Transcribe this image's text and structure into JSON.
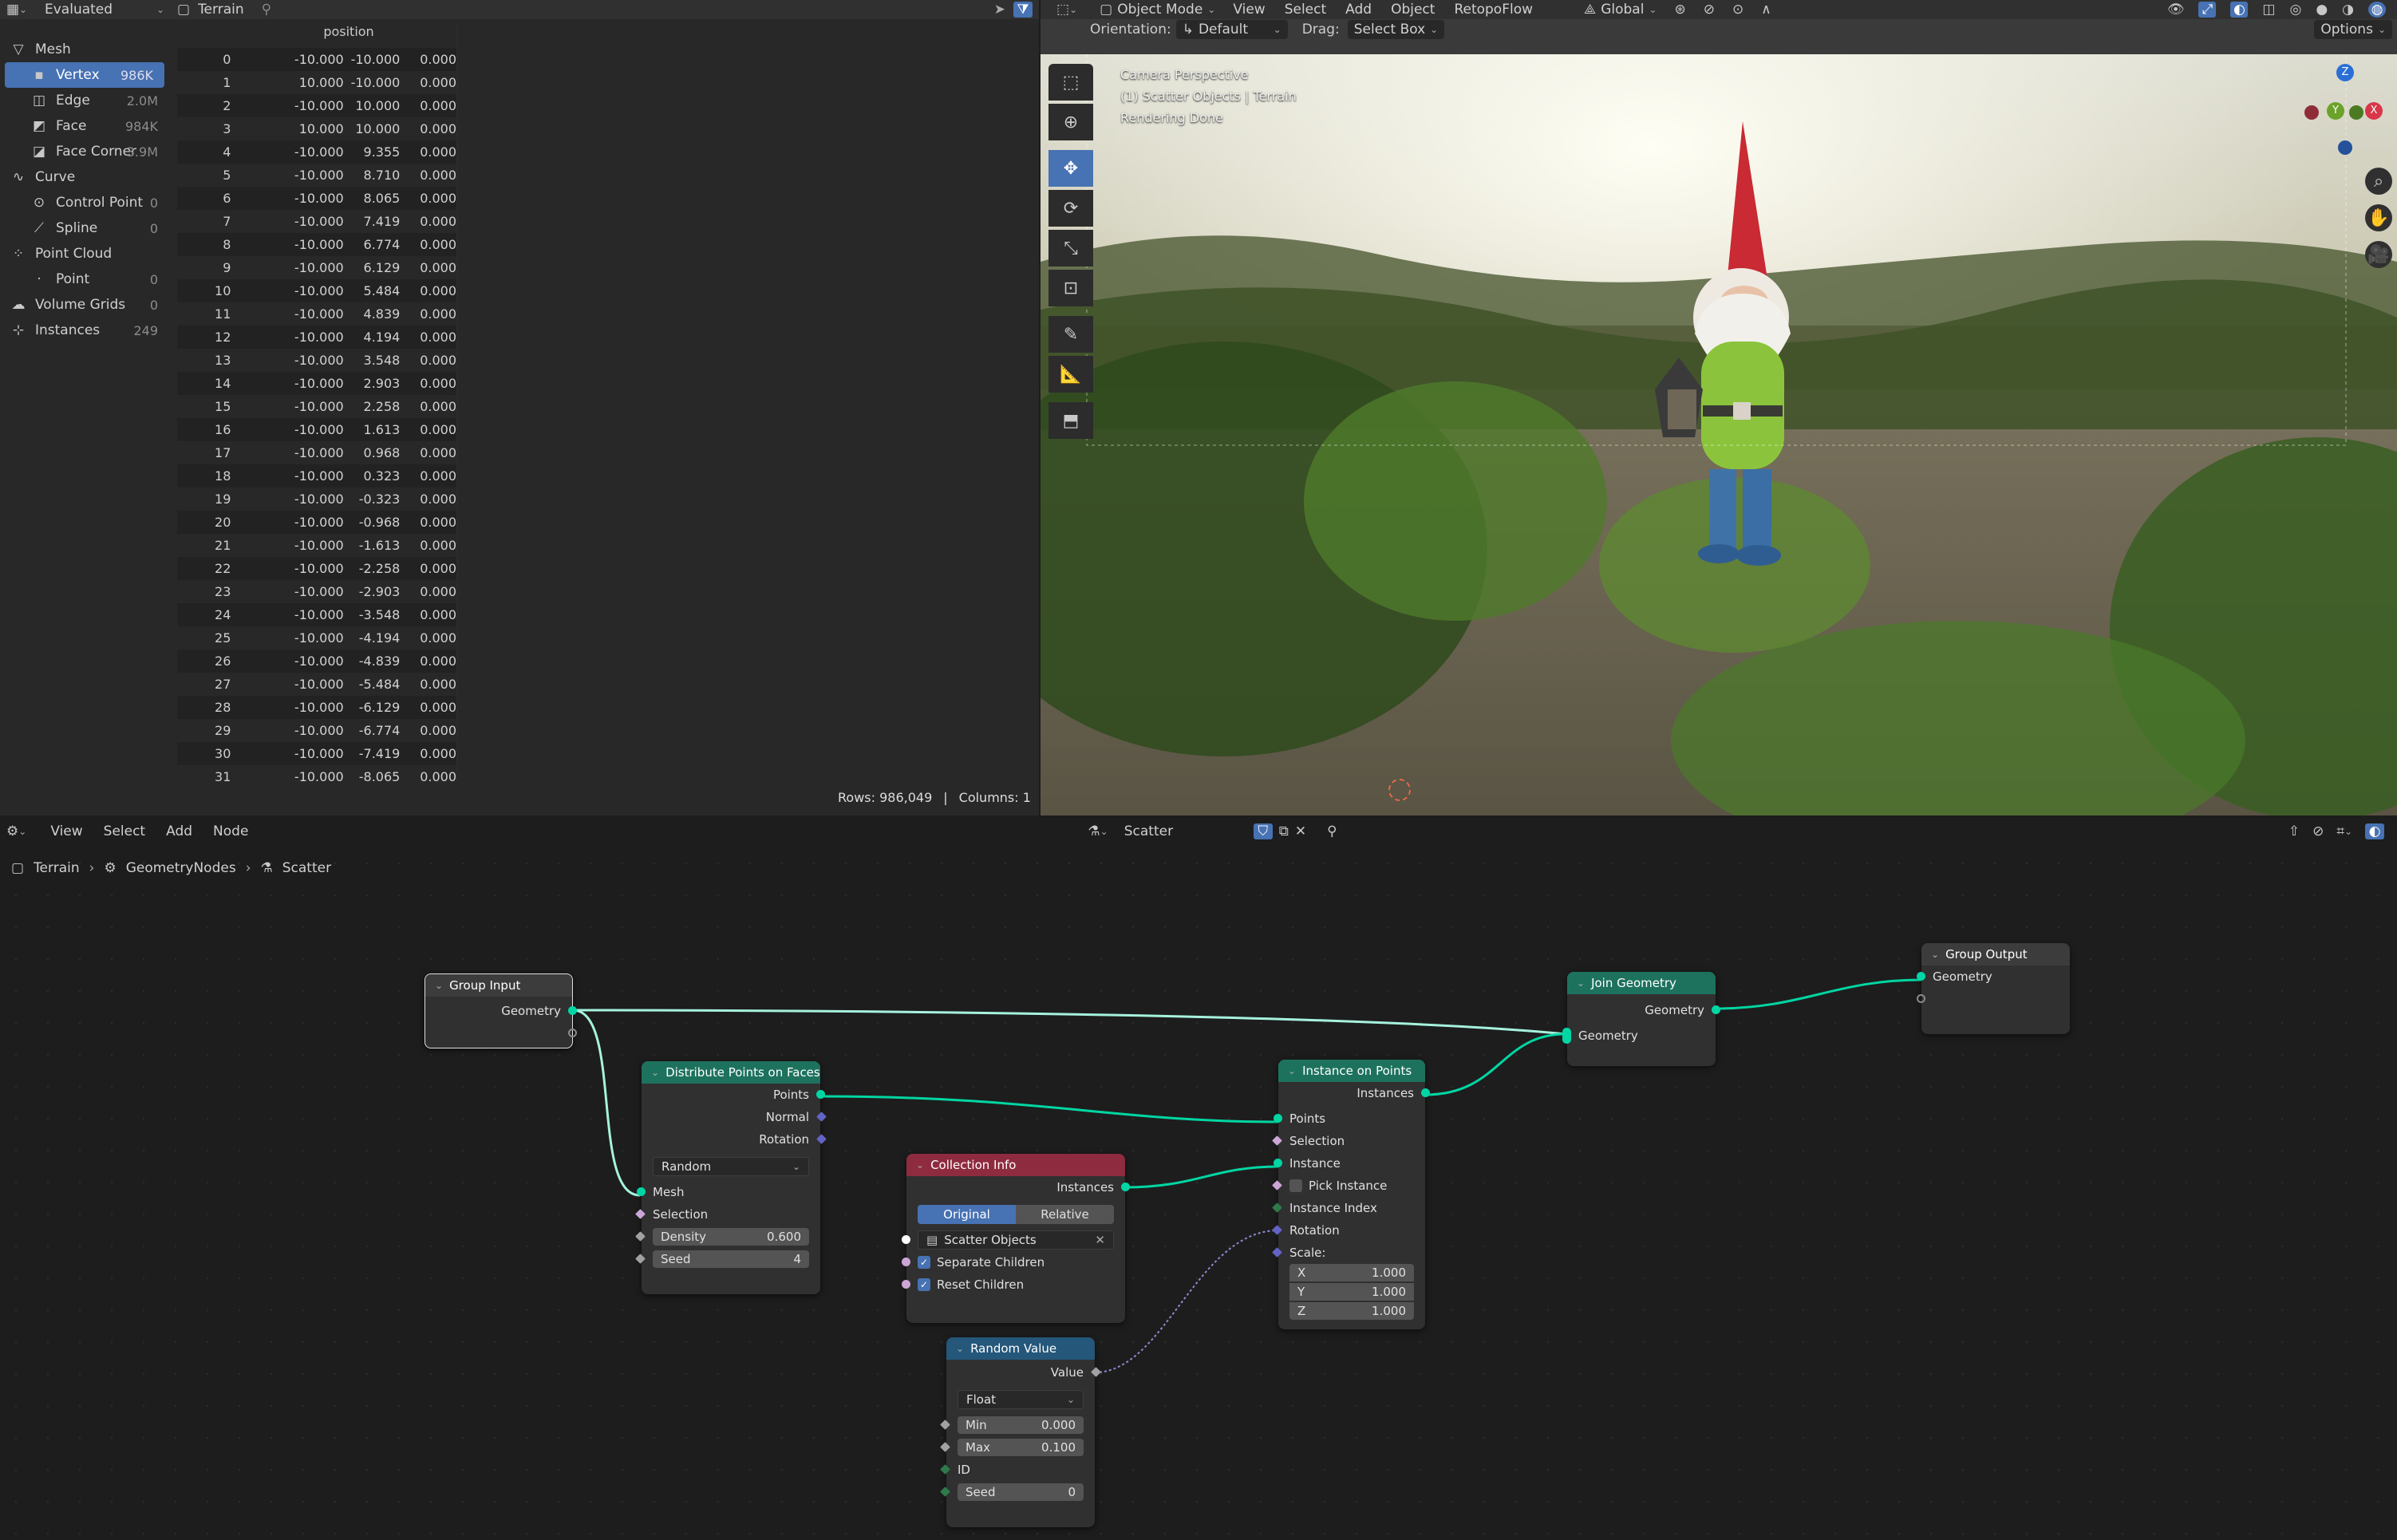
{
  "spreadsheet": {
    "header": {
      "mode": "Evaluated",
      "object": "Terrain"
    },
    "column_header": "position",
    "domains": [
      {
        "label": "Mesh",
        "count": "",
        "level": 0,
        "icon": "mesh-icon"
      },
      {
        "label": "Vertex",
        "count": "986K",
        "level": 1,
        "icon": "vertex-icon",
        "selected": true
      },
      {
        "label": "Edge",
        "count": "2.0M",
        "level": 1,
        "icon": "edge-icon"
      },
      {
        "label": "Face",
        "count": "984K",
        "level": 1,
        "icon": "face-icon"
      },
      {
        "label": "Face Corner",
        "count": "3.9M",
        "level": 1,
        "icon": "face-corner-icon"
      },
      {
        "label": "Curve",
        "count": "",
        "level": 0,
        "icon": "curve-icon"
      },
      {
        "label": "Control Point",
        "count": "0",
        "level": 1,
        "icon": "control-point-icon"
      },
      {
        "label": "Spline",
        "count": "0",
        "level": 1,
        "icon": "spline-icon"
      },
      {
        "label": "Point Cloud",
        "count": "",
        "level": 0,
        "icon": "point-cloud-icon"
      },
      {
        "label": "Point",
        "count": "0",
        "level": 1,
        "icon": "point-icon"
      },
      {
        "label": "Volume Grids",
        "count": "0",
        "level": 0,
        "icon": "volume-icon"
      },
      {
        "label": "Instances",
        "count": "249",
        "level": 0,
        "icon": "instances-icon"
      }
    ],
    "rows": [
      [
        "0",
        "-10.000",
        "-10.000",
        "0.000"
      ],
      [
        "1",
        "10.000",
        "-10.000",
        "0.000"
      ],
      [
        "2",
        "-10.000",
        "10.000",
        "0.000"
      ],
      [
        "3",
        "10.000",
        "10.000",
        "0.000"
      ],
      [
        "4",
        "-10.000",
        "9.355",
        "0.000"
      ],
      [
        "5",
        "-10.000",
        "8.710",
        "0.000"
      ],
      [
        "6",
        "-10.000",
        "8.065",
        "0.000"
      ],
      [
        "7",
        "-10.000",
        "7.419",
        "0.000"
      ],
      [
        "8",
        "-10.000",
        "6.774",
        "0.000"
      ],
      [
        "9",
        "-10.000",
        "6.129",
        "0.000"
      ],
      [
        "10",
        "-10.000",
        "5.484",
        "0.000"
      ],
      [
        "11",
        "-10.000",
        "4.839",
        "0.000"
      ],
      [
        "12",
        "-10.000",
        "4.194",
        "0.000"
      ],
      [
        "13",
        "-10.000",
        "3.548",
        "0.000"
      ],
      [
        "14",
        "-10.000",
        "2.903",
        "0.000"
      ],
      [
        "15",
        "-10.000",
        "2.258",
        "0.000"
      ],
      [
        "16",
        "-10.000",
        "1.613",
        "0.000"
      ],
      [
        "17",
        "-10.000",
        "0.968",
        "0.000"
      ],
      [
        "18",
        "-10.000",
        "0.323",
        "0.000"
      ],
      [
        "19",
        "-10.000",
        "-0.323",
        "0.000"
      ],
      [
        "20",
        "-10.000",
        "-0.968",
        "0.000"
      ],
      [
        "21",
        "-10.000",
        "-1.613",
        "0.000"
      ],
      [
        "22",
        "-10.000",
        "-2.258",
        "0.000"
      ],
      [
        "23",
        "-10.000",
        "-2.903",
        "0.000"
      ],
      [
        "24",
        "-10.000",
        "-3.548",
        "0.000"
      ],
      [
        "25",
        "-10.000",
        "-4.194",
        "0.000"
      ],
      [
        "26",
        "-10.000",
        "-4.839",
        "0.000"
      ],
      [
        "27",
        "-10.000",
        "-5.484",
        "0.000"
      ],
      [
        "28",
        "-10.000",
        "-6.129",
        "0.000"
      ],
      [
        "29",
        "-10.000",
        "-6.774",
        "0.000"
      ],
      [
        "30",
        "-10.000",
        "-7.419",
        "0.000"
      ],
      [
        "31",
        "-10.000",
        "-8.065",
        "0.000"
      ]
    ],
    "footer": {
      "rows": "Rows: 986,049",
      "sep": "|",
      "columns": "Columns: 1"
    }
  },
  "viewport": {
    "header": {
      "mode": "Object Mode",
      "menus": [
        "View",
        "Select",
        "Add",
        "Object",
        "RetopoFlow"
      ],
      "transform": "Global"
    },
    "toolbar2": {
      "orientation_label": "Orientation:",
      "orientation": "Default",
      "drag_label": "Drag:",
      "drag": "Select Box",
      "options": "Options"
    },
    "overlay": {
      "line1": "Camera Perspective",
      "line2": "(1) Scatter Objects | Terrain",
      "line3": "Rendering Done"
    },
    "gizmo": {
      "z": "Z",
      "y": "Y",
      "x": "X"
    }
  },
  "node_editor": {
    "header": {
      "menus": [
        "View",
        "Select",
        "Add",
        "Node"
      ],
      "tree_name": "Scatter"
    },
    "breadcrumb": [
      "Terrain",
      "GeometryNodes",
      "Scatter"
    ],
    "colors": {
      "geometry_header": "#1d725e",
      "collection_header": "#8f2b3f",
      "input_header": "#24577a",
      "group_header": "#3c3c3c",
      "geometry_socket": "#00d6a3",
      "vector_socket": "#6363c7"
    },
    "nodes": {
      "group_input": {
        "title": "Group Input",
        "out": "Geometry"
      },
      "distribute": {
        "title": "Distribute Points on Faces",
        "outs": [
          "Points",
          "Normal",
          "Rotation"
        ],
        "mode": "Random",
        "ins": [
          "Mesh",
          "Selection"
        ],
        "density_label": "Density",
        "density": "0.600",
        "seed_label": "Seed",
        "seed": "4"
      },
      "collection": {
        "title": "Collection Info",
        "out": "Instances",
        "tab_a": "Original",
        "tab_b": "Relative",
        "collection": "Scatter Objects",
        "separate": "Separate Children",
        "reset": "Reset Children"
      },
      "random": {
        "title": "Random Value",
        "out": "Value",
        "type": "Float",
        "min_label": "Min",
        "min": "0.000",
        "max_label": "Max",
        "max": "0.100",
        "id": "ID",
        "seed_label": "Seed",
        "seed": "0"
      },
      "instance": {
        "title": "Instance on Points",
        "out": "Instances",
        "ins": [
          "Points",
          "Selection",
          "Instance",
          "Pick Instance",
          "Instance Index",
          "Rotation",
          "Scale:"
        ],
        "x": "1.000",
        "y": "1.000",
        "z": "1.000",
        "x_label": "X",
        "y_label": "Y",
        "z_label": "Z"
      },
      "join": {
        "title": "Join Geometry",
        "out": "Geometry",
        "in": "Geometry"
      },
      "group_output": {
        "title": "Group Output",
        "in": "Geometry"
      }
    }
  }
}
